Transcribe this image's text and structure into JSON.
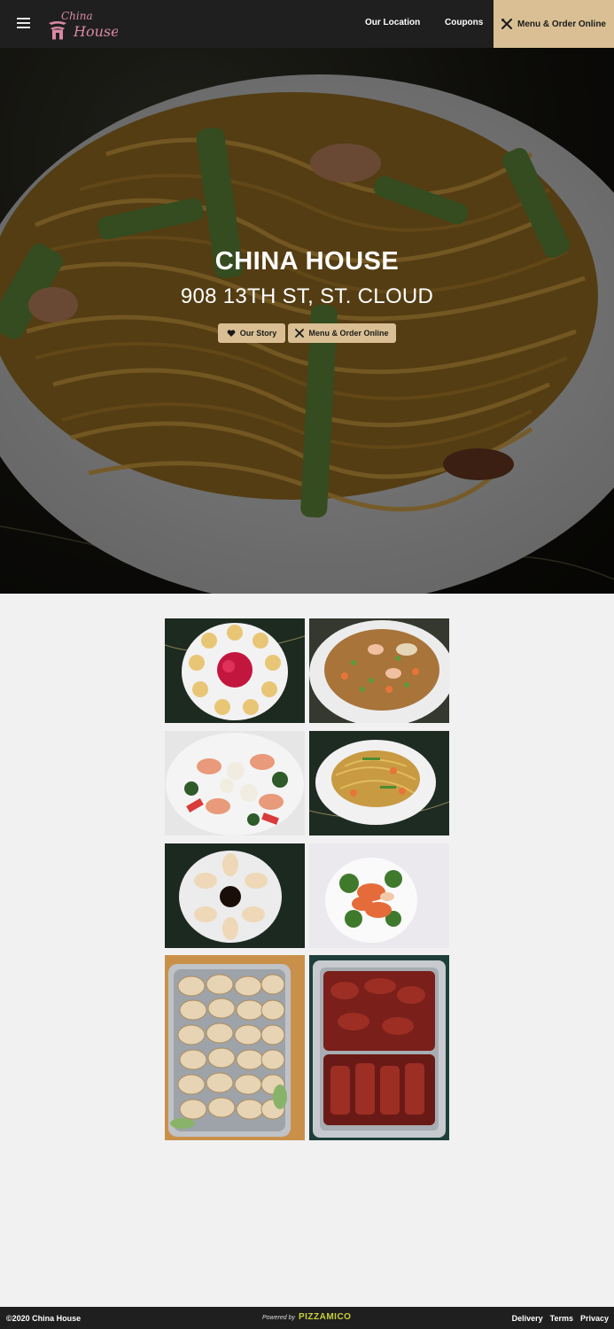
{
  "header": {
    "logo_text": "China House",
    "nav": {
      "location": "Our Location",
      "coupons": "Coupons",
      "order": "Menu & Order Online"
    },
    "icons": {
      "menu": "hamburger-menu-icon",
      "order": "utensils-icon"
    }
  },
  "hero": {
    "title": "CHINA HOUSE",
    "address": "908 13TH ST, ST. CLOUD",
    "buttons": {
      "story": "Our Story",
      "menu": "Menu & Order Online"
    },
    "icons": {
      "story": "heart-icon",
      "menu": "utensils-icon"
    },
    "image": "lo-mein-noodles-photo"
  },
  "gallery": {
    "images": [
      "crab-rangoon-photo",
      "fried-rice-photo",
      "seafood-stir-fry-photo",
      "singapore-noodles-photo",
      "dumplings-plate-photo",
      "shrimp-broccoli-photo",
      "potstickers-tray-photo",
      "spare-ribs-tray-photo"
    ]
  },
  "footer": {
    "copyright": "©2020 China House",
    "powered_label": "Powered by",
    "powered_brand": "PIZZAMICO",
    "links": {
      "delivery": "Delivery",
      "terms": "Terms",
      "privacy": "Privacy"
    }
  },
  "colors": {
    "header_bg": "#1f1f1f",
    "accent": "#d9bf93",
    "page_bg": "#f1f1f1",
    "logo_pink": "#d98aa5"
  }
}
